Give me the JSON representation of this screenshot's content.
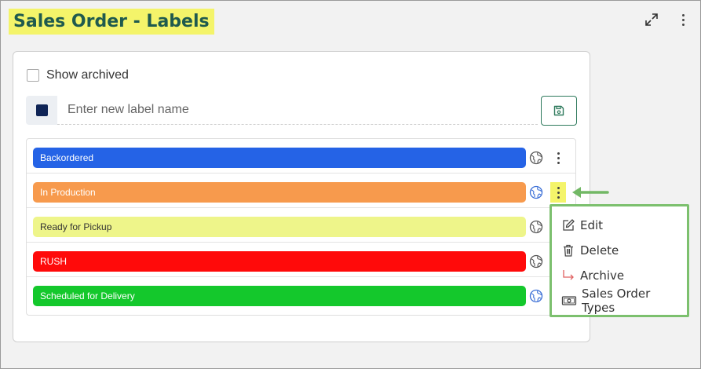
{
  "page": {
    "title": "Sales Order - Labels"
  },
  "show_archived": {
    "label": "Show archived",
    "checked": false
  },
  "new_label": {
    "placeholder": "Enter new label name",
    "color": "#0f2456"
  },
  "labels": [
    {
      "name": "Backordered",
      "color": "#2563e6",
      "text_color": "#ffffff",
      "globe_color": "#555555"
    },
    {
      "name": "In Production",
      "color": "#f79a4d",
      "text_color": "#ffffff",
      "globe_color": "#3b6fd6"
    },
    {
      "name": "Ready for Pickup",
      "color": "#eef58a",
      "text_color": "#333333",
      "globe_color": "#555555"
    },
    {
      "name": "RUSH",
      "color": "#ff0a0a",
      "text_color": "#ffffff",
      "globe_color": "#555555"
    },
    {
      "name": "Scheduled for Delivery",
      "color": "#14c82c",
      "text_color": "#ffffff",
      "globe_color": "#3b6fd6"
    }
  ],
  "context_menu": {
    "items": [
      {
        "label": "Edit",
        "icon": "edit-icon"
      },
      {
        "label": "Delete",
        "icon": "trash-icon"
      },
      {
        "label": "Archive",
        "icon": "archive-arrow-icon"
      },
      {
        "label": "Sales Order Types",
        "icon": "money-icon"
      }
    ]
  },
  "colors": {
    "highlight": "#f4f46a",
    "accent_green": "#7cc06e",
    "title_text": "#1f5a4e"
  }
}
